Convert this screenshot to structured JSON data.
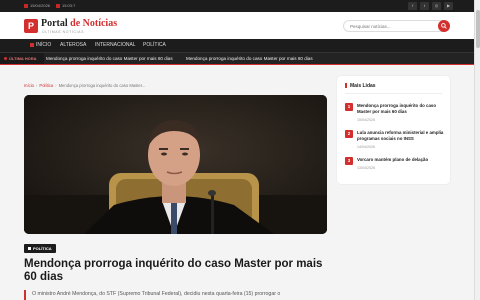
{
  "topbar": {
    "date": "15/04/2026",
    "time": "15:03:7",
    "social_icons": [
      "facebook-icon",
      "twitter-icon",
      "instagram-icon",
      "youtube-icon"
    ]
  },
  "header": {
    "logo_letter": "P",
    "logo_main": "Portal",
    "logo_accent": "de Notícias",
    "logo_sub": "ÚLTIMAS NOTÍCIAS",
    "search_placeholder": "Pesquisar notícias..."
  },
  "nav": {
    "items": [
      "INÍCIO",
      "ALTEROSA",
      "INTERNACIONAL",
      "POLÍTICA"
    ]
  },
  "ticker": {
    "label": "ÚLTIMA HORA",
    "items": [
      "Mendonça prorroga inquérito do caso Master por mais 60 dias",
      "Mendonça prorroga inquérito do caso Master por mais 60 dias"
    ]
  },
  "breadcrumb": {
    "home": "Início",
    "category": "Política",
    "current": "Mendonça prorroga inquérito do caso Master..."
  },
  "article": {
    "category": "POLÍTICA",
    "headline": "Mendonça prorroga inquérito do caso Master por mais 60 dias",
    "lead": "O ministro André Mendonça, do STF (Supremo Tribunal Federal), decidiu nesta quarta-feira (15) prorrogar o"
  },
  "sidebar": {
    "title": "Mais Lidas",
    "items": [
      {
        "num": "1",
        "title": "Mendonça prorroga inquérito do caso Master por mais 60 dias",
        "date": "15/04/2026"
      },
      {
        "num": "2",
        "title": "Lula anuncia reforma ministerial e amplia programas sociais no INSS",
        "date": "14/04/2026"
      },
      {
        "num": "3",
        "title": "Vorcaro mantém plano de delação",
        "date": "13/04/2026"
      }
    ]
  },
  "colors": {
    "accent": "#d32f2f",
    "dark": "#1c1c1c"
  }
}
